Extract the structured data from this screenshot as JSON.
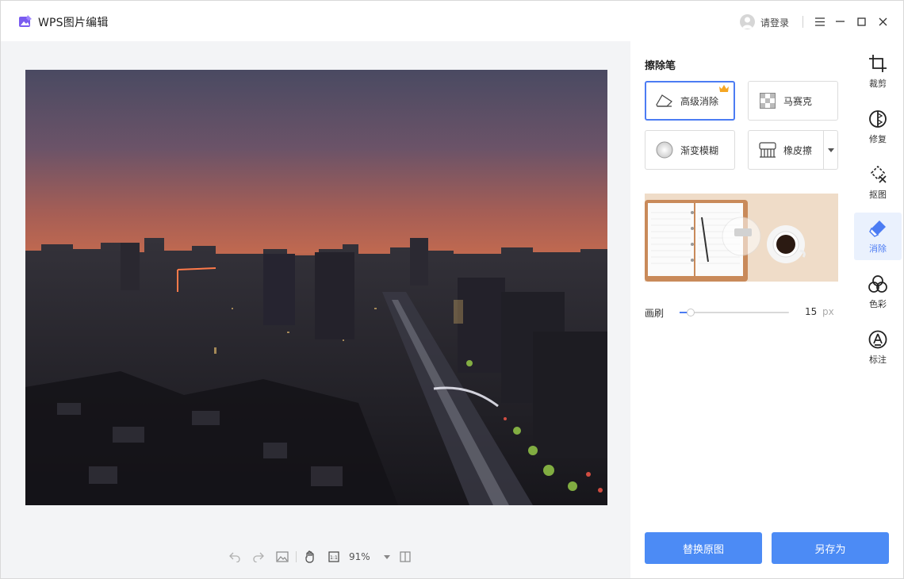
{
  "app": {
    "title": "WPS图片编辑",
    "login_label": "请登录"
  },
  "toolbar": {
    "zoom": "91%"
  },
  "panel": {
    "title": "擦除笔",
    "tools": [
      {
        "label": "高级消除",
        "active": true,
        "premium": true
      },
      {
        "label": "马赛克",
        "active": false
      },
      {
        "label": "渐变模糊",
        "active": false
      },
      {
        "label": "橡皮擦",
        "active": false,
        "has_dropdown": true
      }
    ],
    "brush": {
      "label": "画刷",
      "value": "15",
      "unit": "px",
      "level": 0.1
    },
    "replace_button": "替换原图",
    "save_as_button": "另存为"
  },
  "rail": [
    {
      "label": "裁剪",
      "icon": "crop-icon"
    },
    {
      "label": "修复",
      "icon": "repair-icon"
    },
    {
      "label": "抠图",
      "icon": "cutout-icon"
    },
    {
      "label": "消除",
      "icon": "eraser-icon",
      "active": true
    },
    {
      "label": "色彩",
      "icon": "color-icon"
    },
    {
      "label": "标注",
      "icon": "annotate-icon"
    }
  ],
  "colors": {
    "accent": "#4c7cf3",
    "button": "#4c8bf5",
    "active_bg": "#eaf1fd",
    "canvas_bg": "#f3f4f6"
  }
}
